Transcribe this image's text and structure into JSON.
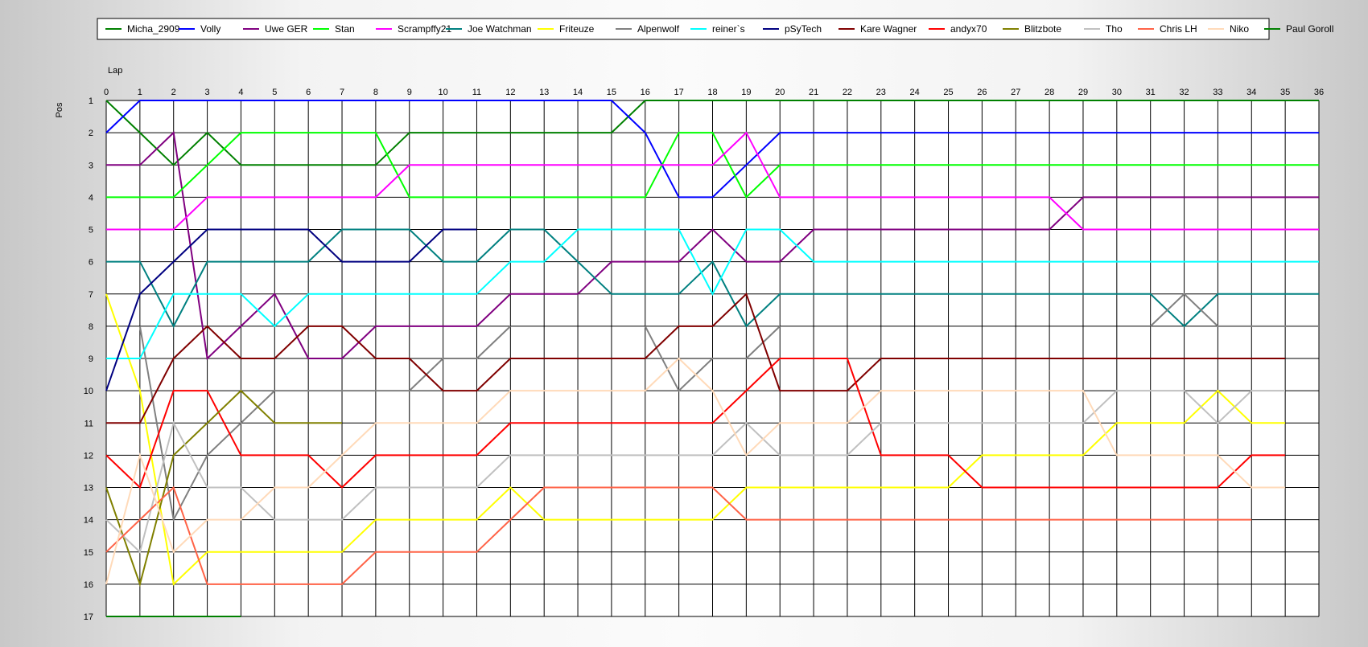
{
  "chart_data": {
    "type": "line",
    "title": "",
    "xlabel": "Lap",
    "ylabel": "Pos",
    "x_ticks": [
      0,
      1,
      2,
      3,
      4,
      5,
      6,
      7,
      8,
      9,
      10,
      11,
      12,
      13,
      14,
      15,
      16,
      17,
      18,
      19,
      20,
      21,
      22,
      23,
      24,
      25,
      26,
      27,
      28,
      29,
      30,
      31,
      32,
      33,
      34,
      35,
      36
    ],
    "y_ticks": [
      1,
      2,
      3,
      4,
      5,
      6,
      7,
      8,
      9,
      10,
      11,
      12,
      13,
      14,
      15,
      16,
      17
    ],
    "xlim": [
      0,
      36
    ],
    "ylim": [
      17,
      1
    ],
    "y_inverted": true,
    "grid": true,
    "legend_position": "top",
    "series": [
      {
        "name": "Micha_2909",
        "color": "#008000",
        "values": [
          1,
          2,
          3,
          2,
          3,
          3,
          3,
          3,
          3,
          2,
          2,
          2,
          2,
          2,
          2,
          2,
          1,
          1,
          1,
          1,
          1,
          1,
          1,
          1,
          1,
          1,
          1,
          1,
          1,
          1,
          1,
          1,
          1,
          1,
          1,
          1,
          1
        ]
      },
      {
        "name": "Volly",
        "color": "#0000ff",
        "values": [
          2,
          1,
          1,
          1,
          1,
          1,
          1,
          1,
          1,
          1,
          1,
          1,
          1,
          1,
          1,
          1,
          2,
          4,
          4,
          3,
          2,
          2,
          2,
          2,
          2,
          2,
          2,
          2,
          2,
          2,
          2,
          2,
          2,
          2,
          2,
          2,
          2
        ]
      },
      {
        "name": "Uwe GER",
        "color": "#800080",
        "values": [
          3,
          3,
          2,
          9,
          8,
          7,
          9,
          9,
          8,
          8,
          8,
          8,
          7,
          7,
          7,
          6,
          6,
          6,
          5,
          6,
          6,
          5,
          5,
          5,
          5,
          5,
          5,
          5,
          5,
          4,
          4,
          4,
          4,
          4,
          4,
          4,
          4
        ]
      },
      {
        "name": "Stan",
        "color": "#00ff00",
        "values": [
          4,
          4,
          4,
          3,
          2,
          2,
          2,
          2,
          2,
          4,
          4,
          4,
          4,
          4,
          4,
          4,
          4,
          2,
          2,
          4,
          3,
          3,
          3,
          3,
          3,
          3,
          3,
          3,
          3,
          3,
          3,
          3,
          3,
          3,
          3,
          3,
          3
        ]
      },
      {
        "name": "Scrampffy21",
        "color": "#ff00ff",
        "values": [
          5,
          5,
          5,
          4,
          4,
          4,
          4,
          4,
          4,
          3,
          3,
          3,
          3,
          3,
          3,
          3,
          3,
          3,
          3,
          2,
          4,
          4,
          4,
          4,
          4,
          4,
          4,
          4,
          4,
          5,
          5,
          5,
          5,
          5,
          5,
          5,
          5
        ]
      },
      {
        "name": "Joe Watchman",
        "color": "#008080",
        "values": [
          6,
          6,
          8,
          6,
          6,
          6,
          6,
          5,
          5,
          5,
          6,
          6,
          5,
          5,
          6,
          7,
          7,
          7,
          6,
          8,
          7,
          7,
          7,
          7,
          7,
          7,
          7,
          7,
          7,
          7,
          7,
          7,
          8,
          7,
          7,
          7,
          7
        ]
      },
      {
        "name": "Friteuze",
        "color": "#ffff00",
        "values": [
          7,
          10,
          16,
          15,
          15,
          15,
          15,
          15,
          14,
          14,
          14,
          14,
          13,
          14,
          14,
          14,
          14,
          14,
          14,
          13,
          13,
          13,
          13,
          13,
          13,
          13,
          12,
          12,
          12,
          12,
          11,
          11,
          11,
          10,
          11,
          11,
          null
        ]
      },
      {
        "name": "Alpenwolf",
        "color": "#808080",
        "values": [
          null,
          8,
          14,
          12,
          11,
          10,
          10,
          10,
          10,
          10,
          9,
          9,
          8,
          null,
          null,
          null,
          8,
          10,
          9,
          9,
          8,
          null,
          null,
          null,
          null,
          null,
          null,
          null,
          null,
          null,
          null,
          8,
          7,
          8,
          8,
          8,
          8
        ]
      },
      {
        "name": "reiner`s",
        "color": "#00ffff",
        "values": [
          9,
          9,
          7,
          7,
          7,
          8,
          7,
          7,
          7,
          7,
          7,
          7,
          6,
          6,
          5,
          5,
          5,
          5,
          7,
          5,
          5,
          6,
          6,
          6,
          6,
          6,
          6,
          6,
          6,
          6,
          6,
          6,
          6,
          6,
          6,
          6,
          6
        ]
      },
      {
        "name": "pSyTech",
        "color": "#000080",
        "values": [
          10,
          7,
          6,
          5,
          5,
          5,
          5,
          6,
          6,
          6,
          5,
          5,
          null,
          null,
          null,
          null,
          null,
          null,
          null,
          null,
          null,
          null,
          null,
          null,
          null,
          null,
          null,
          null,
          null,
          null,
          null,
          null,
          null,
          null,
          null,
          null,
          null
        ]
      },
      {
        "name": "Kare Wagner",
        "color": "#800000",
        "values": [
          11,
          11,
          9,
          8,
          9,
          9,
          8,
          8,
          9,
          9,
          10,
          10,
          9,
          9,
          9,
          9,
          9,
          8,
          8,
          7,
          10,
          10,
          10,
          9,
          9,
          9,
          9,
          9,
          9,
          9,
          9,
          9,
          9,
          9,
          9,
          9,
          null
        ]
      },
      {
        "name": "andyx70",
        "color": "#ff0000",
        "values": [
          12,
          13,
          10,
          10,
          12,
          12,
          12,
          13,
          12,
          12,
          12,
          12,
          11,
          11,
          11,
          11,
          11,
          11,
          11,
          10,
          9,
          9,
          9,
          12,
          12,
          12,
          13,
          13,
          13,
          13,
          13,
          13,
          13,
          13,
          12,
          12,
          null
        ]
      },
      {
        "name": "Blitzbote",
        "color": "#808000",
        "values": [
          13,
          16,
          12,
          11,
          10,
          11,
          11,
          11,
          null,
          null,
          null,
          null,
          null,
          null,
          null,
          null,
          null,
          null,
          null,
          null,
          null,
          null,
          null,
          null,
          null,
          null,
          null,
          null,
          null,
          null,
          null,
          null,
          null,
          null,
          null,
          null,
          null
        ]
      },
      {
        "name": "Tho",
        "color": "#c0c0c0",
        "values": [
          14,
          15,
          11,
          13,
          13,
          14,
          14,
          14,
          13,
          13,
          13,
          13,
          12,
          12,
          12,
          12,
          12,
          12,
          12,
          11,
          12,
          12,
          12,
          11,
          11,
          11,
          11,
          11,
          11,
          11,
          10,
          10,
          10,
          11,
          10,
          10,
          null
        ]
      },
      {
        "name": "Chris LH",
        "color": "#ff6347",
        "values": [
          15,
          14,
          13,
          16,
          16,
          16,
          16,
          16,
          15,
          15,
          15,
          15,
          14,
          13,
          13,
          13,
          13,
          13,
          13,
          14,
          14,
          14,
          14,
          14,
          14,
          14,
          14,
          14,
          14,
          14,
          14,
          14,
          14,
          14,
          14,
          null,
          null
        ]
      },
      {
        "name": "Niko",
        "color": "#ffdab9",
        "values": [
          16,
          12,
          15,
          14,
          14,
          13,
          13,
          12,
          11,
          11,
          11,
          11,
          10,
          10,
          10,
          10,
          10,
          9,
          10,
          12,
          11,
          11,
          11,
          10,
          10,
          10,
          10,
          10,
          10,
          10,
          12,
          12,
          12,
          12,
          13,
          13,
          null
        ]
      },
      {
        "name": "Paul Goroll",
        "color": "#008000",
        "values": [
          17,
          17,
          17,
          17,
          17,
          null,
          null,
          null,
          null,
          null,
          null,
          null,
          null,
          null,
          null,
          null,
          null,
          null,
          null,
          null,
          null,
          null,
          null,
          null,
          null,
          null,
          null,
          null,
          null,
          null,
          null,
          null,
          null,
          null,
          null,
          null,
          null
        ]
      }
    ]
  }
}
